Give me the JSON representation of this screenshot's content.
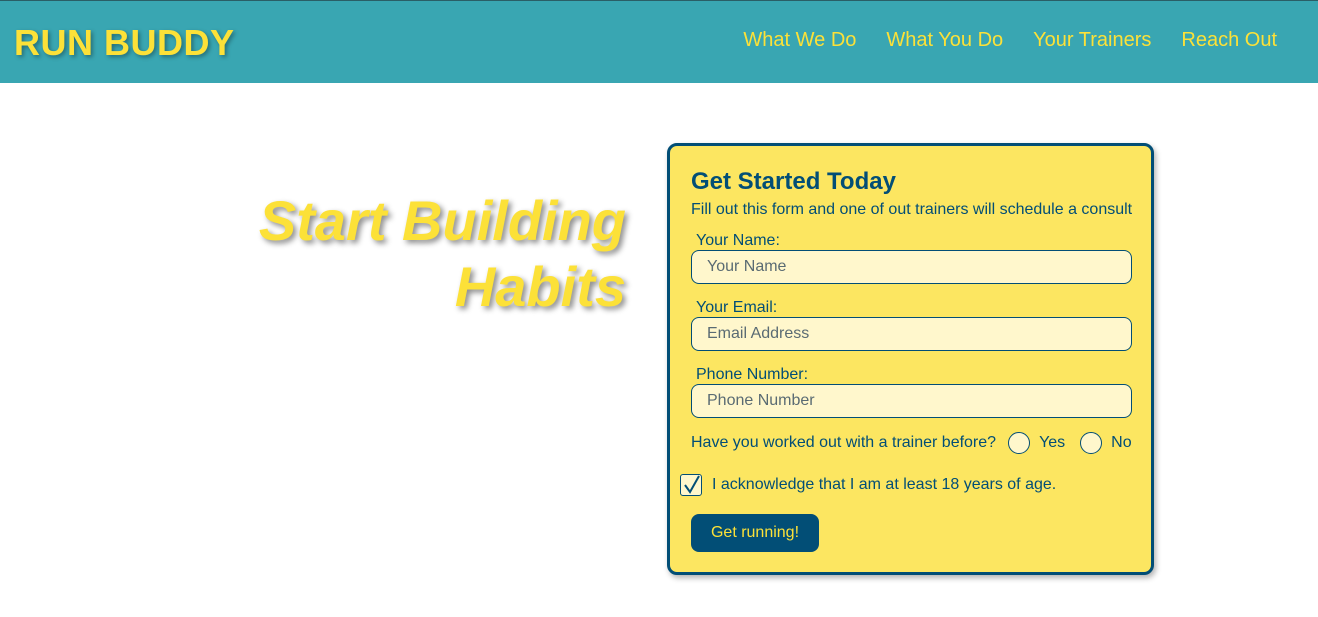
{
  "header": {
    "logo": "RUN BUDDY",
    "nav": [
      "What We Do",
      "What You Do",
      "Your Trainers",
      "Reach Out"
    ]
  },
  "hero": {
    "line1": "Start Building",
    "line2": "Habits"
  },
  "form": {
    "title": "Get Started Today",
    "subtitle": "Fill out this form and one of out trainers will schedule a consult",
    "name_label": "Your Name:",
    "name_placeholder": "Your Name",
    "email_label": "Your Email:",
    "email_placeholder": "Email Address",
    "phone_label": "Phone Number:",
    "phone_placeholder": "Phone Number",
    "trainer_question": "Have you worked out with a trainer before?",
    "yes_label": "Yes",
    "no_label": "No",
    "age_ack": "I acknowledge that I am at least 18 years of age.",
    "age_checked": true,
    "submit_label": "Get running!"
  },
  "colors": {
    "header_bg": "#39a6b2",
    "accent_yellow": "#fce138",
    "form_bg": "#fce661",
    "navy": "#024e76"
  }
}
